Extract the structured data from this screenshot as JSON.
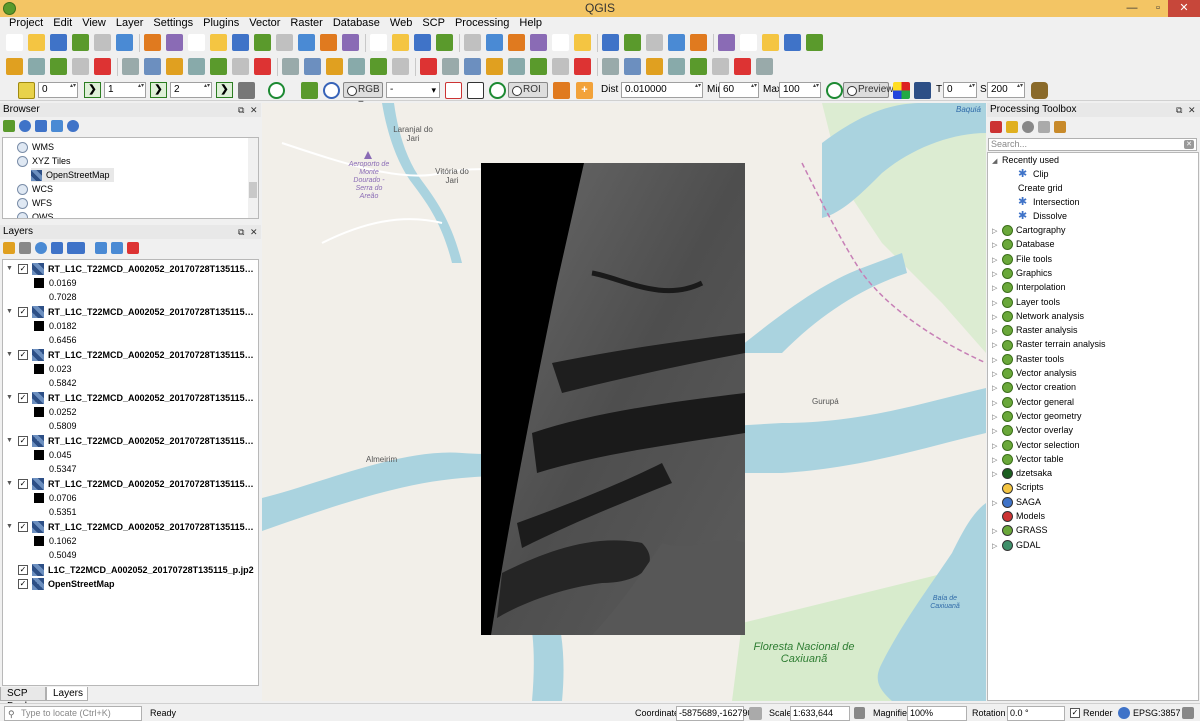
{
  "window": {
    "title": "QGIS",
    "min_symbol": "—",
    "max_symbol": "▫",
    "close_symbol": "✕"
  },
  "menu": [
    "Project",
    "Edit",
    "View",
    "Layer",
    "Settings",
    "Plugins",
    "Vector",
    "Raster",
    "Database",
    "Web",
    "SCP",
    "Processing",
    "Help"
  ],
  "scp_toolbar": {
    "band_r": "0",
    "band_g": "1",
    "band_b": "2",
    "rgb_label": "RGB =",
    "rgb_value": "-",
    "roi_label": "ROI",
    "dist_label": "Dist",
    "dist_value": "0.010000",
    "min_label": "Min",
    "min_value": "60",
    "max_label": "Max",
    "max_value": "100",
    "preview_label": "Preview",
    "t_label": "T",
    "t_value": "0",
    "s_label": "S",
    "s_value": "200",
    "step_symbol": "❯"
  },
  "browser": {
    "title": "Browser",
    "items": [
      {
        "label": "WMS",
        "indent": 0,
        "icon": "globe"
      },
      {
        "label": "XYZ Tiles",
        "indent": 0,
        "icon": "globe",
        "expanded": true
      },
      {
        "label": "OpenStreetMap",
        "indent": 1,
        "icon": "tile",
        "selected": true
      },
      {
        "label": "WCS",
        "indent": 0,
        "icon": "globe"
      },
      {
        "label": "WFS",
        "indent": 0,
        "icon": "globe"
      },
      {
        "label": "OWS",
        "indent": 0,
        "icon": "globe"
      }
    ]
  },
  "layers": {
    "title": "Layers",
    "items": [
      {
        "name": "RT_L1C_T22MCD_A002052_20170728T135115_B...",
        "min": "0.0169",
        "max": "0.7028"
      },
      {
        "name": "RT_L1C_T22MCD_A002052_20170728T135115_B...",
        "min": "0.0182",
        "max": "0.6456"
      },
      {
        "name": "RT_L1C_T22MCD_A002052_20170728T135115_B...",
        "min": "0.023",
        "max": "0.5842"
      },
      {
        "name": "RT_L1C_T22MCD_A002052_20170728T135115_B...",
        "min": "0.0252",
        "max": "0.5809"
      },
      {
        "name": "RT_L1C_T22MCD_A002052_20170728T135115_B...",
        "min": "0.045",
        "max": "0.5347"
      },
      {
        "name": "RT_L1C_T22MCD_A002052_20170728T135115_B...",
        "min": "0.0706",
        "max": "0.5351"
      },
      {
        "name": "RT_L1C_T22MCD_A002052_20170728T135115_B...",
        "min": "0.1062",
        "max": "0.5049"
      }
    ],
    "extra": [
      {
        "name": "L1C_T22MCD_A002052_20170728T135115_p.jp2"
      },
      {
        "name": "OpenStreetMap"
      }
    ],
    "expand_symbol": "▼",
    "check_symbol": "✓"
  },
  "dock_tabs": {
    "scp": "SCP Dock",
    "layers": "Layers"
  },
  "map": {
    "labels": {
      "laranjal": "Laranjal do Jari",
      "vitoria": "Vitória do Jari",
      "airport": "Aeroporto de Monte Dourado - Serra do Areão",
      "almeirim": "Almeirim",
      "gurupa": "Gurupá",
      "baqui": "Baquiá",
      "baia": "Baía de Caxiuanã",
      "floresta": "Floresta Nacional de Caxiuanã"
    }
  },
  "processing": {
    "title": "Processing Toolbox",
    "search_placeholder": "Search...",
    "recently_used": "Recently used",
    "recent": [
      "Clip",
      "Create grid",
      "Intersection",
      "Dissolve"
    ],
    "groups": [
      "Cartography",
      "Database",
      "File tools",
      "Graphics",
      "Interpolation",
      "Layer tools",
      "Network analysis",
      "Raster analysis",
      "Raster terrain analysis",
      "Raster tools",
      "Vector analysis",
      "Vector creation",
      "Vector general",
      "Vector geometry",
      "Vector overlay",
      "Vector selection",
      "Vector table"
    ],
    "providers": [
      "dzetsaka",
      "Scripts",
      "SAGA",
      "Models",
      "GRASS",
      "GDAL"
    ]
  },
  "status": {
    "locator_placeholder": "Type to locate (Ctrl+K)",
    "ready": "Ready",
    "coordinate_label": "Coordinate",
    "coordinate_value": "-5875689,-162790",
    "scale_label": "Scale",
    "scale_value": "1:633,644",
    "magnifier_label": "Magnifier",
    "magnifier_value": "100%",
    "rotation_label": "Rotation",
    "rotation_value": "0.0 °",
    "render_label": "Render",
    "crs": "EPSG:3857"
  }
}
